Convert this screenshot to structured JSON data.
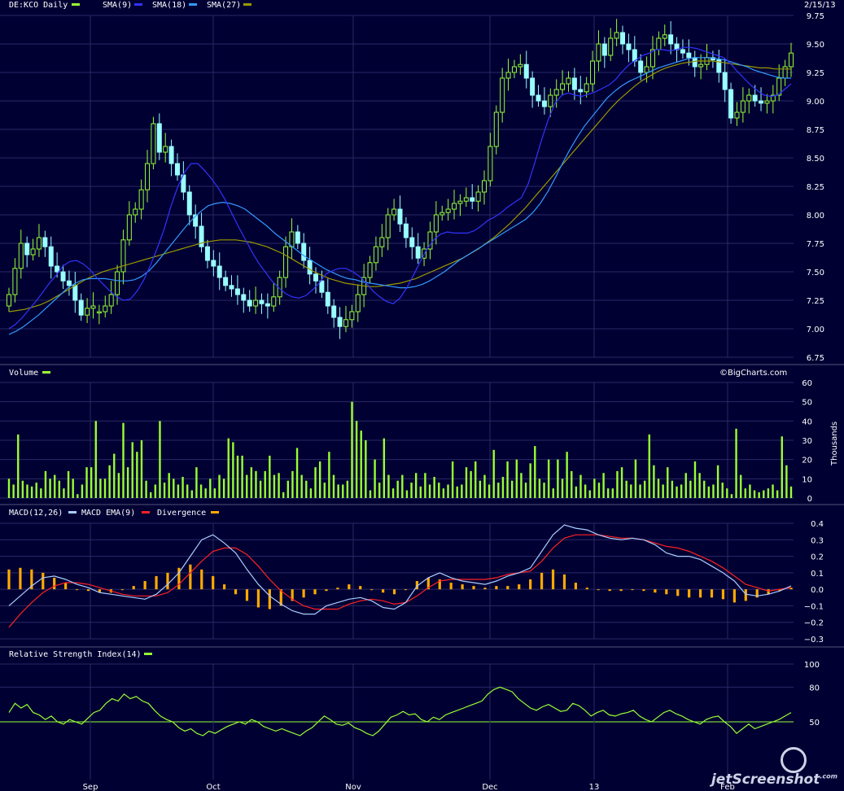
{
  "header": {
    "symbol_label": "DE:KCO Daily",
    "sma_labels": [
      "SMA(9)",
      "SMA(18)",
      "SMA(27)"
    ],
    "date": "2/15/13"
  },
  "volume_panel": {
    "label": "Volume",
    "unit": "Thousands",
    "credit": "©BigCharts.com"
  },
  "macd_panel": {
    "label1": "MACD(12,26)",
    "label2": "MACD EMA(9)",
    "label3": "Divergence"
  },
  "rsi_panel": {
    "label": "Relative Strength Index(14)"
  },
  "watermark": {
    "text": "jetScreenshot",
    "small": ".com"
  },
  "colors": {
    "background": "#000033",
    "up_candle": "#000033",
    "up_outline": "#99ff33",
    "down_candle": "#99ffff",
    "sma9": "#3333ff",
    "sma18": "#3399ff",
    "sma27": "#999900",
    "volume": "#99ff33",
    "macd": "#aaccff",
    "macd_ema": "#ff2222",
    "divergence": "#ffaa00",
    "rsi": "#99ff33"
  },
  "chart_data": [
    {
      "type": "candlestick",
      "title": "DE:KCO Daily",
      "ylim": [
        6.75,
        9.75
      ],
      "yticks": [
        "6.75",
        "7.00",
        "7.25",
        "7.50",
        "7.75",
        "8.00",
        "8.25",
        "8.50",
        "8.75",
        "9.00",
        "9.25",
        "9.50",
        "9.75"
      ],
      "x_labels": [
        "Sep",
        "Oct",
        "Nov",
        "Dec",
        "13",
        "Feb"
      ],
      "series_names": [
        "SMA(9)",
        "SMA(18)",
        "SMA(27)"
      ],
      "close": [
        7.3,
        7.53,
        7.75,
        7.65,
        7.7,
        7.8,
        7.72,
        7.55,
        7.5,
        7.42,
        7.38,
        7.25,
        7.12,
        7.18,
        7.2,
        7.15,
        7.2,
        7.3,
        7.5,
        7.78,
        8.0,
        8.05,
        8.22,
        8.45,
        8.8,
        8.55,
        8.6,
        8.45,
        8.35,
        8.2,
        8.0,
        7.9,
        7.72,
        7.6,
        7.55,
        7.45,
        7.38,
        7.35,
        7.3,
        7.25,
        7.2,
        7.25,
        7.22,
        7.2,
        7.28,
        7.45,
        7.72,
        7.85,
        7.75,
        7.6,
        7.48,
        7.42,
        7.32,
        7.2,
        7.1,
        7.02,
        7.08,
        7.15,
        7.3,
        7.45,
        7.58,
        7.72,
        7.8,
        8.0,
        8.05,
        7.92,
        7.8,
        7.72,
        7.62,
        7.7,
        7.85,
        8.0,
        8.02,
        8.05,
        8.1,
        8.12,
        8.15,
        8.12,
        8.2,
        8.3,
        8.6,
        8.9,
        9.2,
        9.25,
        9.3,
        9.32,
        9.2,
        9.05,
        9.0,
        8.95,
        9.05,
        9.1,
        9.15,
        9.2,
        9.1,
        9.08,
        9.15,
        9.35,
        9.5,
        9.4,
        9.55,
        9.6,
        9.5,
        9.45,
        9.35,
        9.25,
        9.3,
        9.45,
        9.55,
        9.58,
        9.5,
        9.45,
        9.42,
        9.38,
        9.3,
        9.32,
        9.38,
        9.36,
        9.25,
        9.1,
        8.85,
        8.9,
        9.0,
        9.05,
        9.0,
        8.98,
        9.0,
        9.05,
        9.2,
        9.3,
        9.42
      ],
      "open": [
        7.2,
        7.3,
        7.53,
        7.75,
        7.65,
        7.7,
        7.8,
        7.72,
        7.55,
        7.5,
        7.42,
        7.38,
        7.25,
        7.12,
        7.18,
        7.15,
        7.15,
        7.2,
        7.3,
        7.5,
        7.78,
        8.0,
        8.05,
        8.22,
        8.45,
        8.8,
        8.55,
        8.6,
        8.45,
        8.35,
        8.2,
        8.0,
        7.9,
        7.72,
        7.6,
        7.55,
        7.45,
        7.38,
        7.35,
        7.3,
        7.25,
        7.2,
        7.25,
        7.22,
        7.2,
        7.28,
        7.45,
        7.72,
        7.85,
        7.75,
        7.6,
        7.48,
        7.42,
        7.32,
        7.2,
        7.1,
        7.02,
        7.08,
        7.15,
        7.3,
        7.45,
        7.58,
        7.72,
        7.8,
        8.0,
        8.05,
        7.92,
        7.8,
        7.72,
        7.62,
        7.7,
        7.85,
        8.0,
        8.02,
        8.05,
        8.1,
        8.12,
        8.15,
        8.12,
        8.2,
        8.3,
        8.6,
        8.9,
        9.2,
        9.25,
        9.3,
        9.32,
        9.2,
        9.05,
        9.0,
        8.95,
        9.05,
        9.1,
        9.15,
        9.2,
        9.1,
        9.08,
        9.15,
        9.35,
        9.5,
        9.4,
        9.55,
        9.6,
        9.5,
        9.45,
        9.35,
        9.25,
        9.3,
        9.45,
        9.55,
        9.58,
        9.5,
        9.45,
        9.42,
        9.38,
        9.3,
        9.32,
        9.38,
        9.36,
        9.25,
        9.1,
        8.85,
        8.9,
        9.0,
        9.05,
        9.0,
        8.98,
        9.0,
        9.05,
        9.2,
        9.3
      ],
      "sma9": [
        7.0,
        7.04,
        7.1,
        7.17,
        7.24,
        7.32,
        7.4,
        7.47,
        7.55,
        7.59,
        7.6,
        7.57,
        7.52,
        7.45,
        7.39,
        7.33,
        7.28,
        7.25,
        7.26,
        7.33,
        7.43,
        7.56,
        7.71,
        7.87,
        8.07,
        8.24,
        8.37,
        8.45,
        8.45,
        8.39,
        8.32,
        8.24,
        8.14,
        8.02,
        7.9,
        7.79,
        7.68,
        7.58,
        7.5,
        7.42,
        7.36,
        7.31,
        7.28,
        7.27,
        7.29,
        7.34,
        7.4,
        7.48,
        7.51,
        7.53,
        7.53,
        7.5,
        7.46,
        7.4,
        7.33,
        7.28,
        7.24,
        7.22,
        7.27,
        7.36,
        7.47,
        7.59,
        7.7,
        7.78,
        7.83,
        7.85,
        7.84,
        7.84,
        7.84,
        7.86,
        7.9,
        7.95,
        7.98,
        8.02,
        8.07,
        8.11,
        8.15,
        8.27,
        8.46,
        8.66,
        8.84,
        8.98,
        9.05,
        9.07,
        9.05,
        9.04,
        9.06,
        9.08,
        9.11,
        9.14,
        9.19,
        9.26,
        9.32,
        9.36,
        9.4,
        9.42,
        9.45,
        9.45,
        9.44,
        9.45,
        9.47,
        9.47,
        9.46,
        9.44,
        9.42,
        9.4,
        9.38,
        9.33,
        9.26,
        9.2,
        9.14,
        9.09,
        9.05,
        9.04,
        9.05,
        9.1,
        9.15
      ],
      "sma18": [
        6.95,
        6.98,
        7.02,
        7.07,
        7.12,
        7.18,
        7.24,
        7.3,
        7.36,
        7.4,
        7.43,
        7.44,
        7.44,
        7.44,
        7.43,
        7.42,
        7.42,
        7.43,
        7.46,
        7.51,
        7.58,
        7.66,
        7.74,
        7.82,
        7.9,
        7.97,
        8.03,
        8.08,
        8.1,
        8.11,
        8.1,
        8.08,
        8.05,
        8.0,
        7.95,
        7.9,
        7.84,
        7.79,
        7.74,
        7.69,
        7.64,
        7.6,
        7.56,
        7.52,
        7.49,
        7.46,
        7.44,
        7.43,
        7.41,
        7.4,
        7.39,
        7.38,
        7.37,
        7.36,
        7.36,
        7.37,
        7.39,
        7.42,
        7.46,
        7.5,
        7.55,
        7.6,
        7.64,
        7.68,
        7.72,
        7.76,
        7.8,
        7.84,
        7.88,
        7.92,
        7.96,
        8.02,
        8.1,
        8.2,
        8.32,
        8.45,
        8.57,
        8.68,
        8.78,
        8.86,
        8.94,
        9.02,
        9.08,
        9.13,
        9.17,
        9.2,
        9.23,
        9.26,
        9.29,
        9.31,
        9.33,
        9.35,
        9.37,
        9.38,
        9.38,
        9.38,
        9.37,
        9.36,
        9.34,
        9.32,
        9.3,
        9.27,
        9.25,
        9.23,
        9.21,
        9.2,
        9.2
      ],
      "sma27": [
        7.15,
        7.16,
        7.17,
        7.19,
        7.21,
        7.24,
        7.28,
        7.32,
        7.36,
        7.4,
        7.44,
        7.47,
        7.5,
        7.52,
        7.54,
        7.56,
        7.58,
        7.6,
        7.62,
        7.64,
        7.66,
        7.68,
        7.7,
        7.72,
        7.74,
        7.76,
        7.77,
        7.78,
        7.78,
        7.78,
        7.77,
        7.76,
        7.74,
        7.72,
        7.69,
        7.66,
        7.62,
        7.58,
        7.54,
        7.5,
        7.47,
        7.44,
        7.42,
        7.4,
        7.39,
        7.38,
        7.37,
        7.37,
        7.38,
        7.39,
        7.4,
        7.42,
        7.44,
        7.47,
        7.5,
        7.53,
        7.56,
        7.59,
        7.62,
        7.66,
        7.7,
        7.75,
        7.8,
        7.86,
        7.92,
        7.99,
        8.06,
        8.14,
        8.22,
        8.3,
        8.38,
        8.46,
        8.54,
        8.62,
        8.7,
        8.78,
        8.86,
        8.94,
        9.01,
        9.07,
        9.13,
        9.18,
        9.22,
        9.26,
        9.29,
        9.31,
        9.33,
        9.34,
        9.35,
        9.35,
        9.35,
        9.34,
        9.33,
        9.32,
        9.31,
        9.3,
        9.29,
        9.29,
        9.28,
        9.28,
        9.28
      ]
    },
    {
      "type": "bar",
      "title": "Volume",
      "ylabel": "Thousands",
      "ylim": [
        0,
        60
      ],
      "yticks": [
        "0",
        "10",
        "20",
        "30",
        "40",
        "50",
        "60"
      ],
      "values": [
        10,
        7,
        33,
        9,
        7,
        6,
        8,
        5,
        14,
        10,
        12,
        9,
        5,
        14,
        10,
        2,
        7,
        16,
        16,
        40,
        10,
        10,
        17,
        23,
        13,
        39,
        16,
        29,
        24,
        30,
        9,
        3,
        7,
        40,
        8,
        13,
        10,
        7,
        11,
        7,
        4,
        16,
        7,
        5,
        10,
        5,
        12,
        10,
        31,
        29,
        22,
        22,
        12,
        16,
        14,
        9,
        14,
        22,
        12,
        13,
        3,
        9,
        14,
        26,
        12,
        9,
        5,
        16,
        19,
        8,
        24,
        12,
        7,
        7,
        9,
        50,
        40,
        35,
        30,
        4,
        20,
        8,
        31,
        12,
        5,
        9,
        12,
        4,
        8,
        13,
        6,
        13,
        7,
        11,
        8,
        5,
        7,
        19,
        6,
        7,
        16,
        14,
        19,
        9,
        12,
        7,
        25,
        8,
        11,
        19,
        9,
        20,
        13,
        8,
        18,
        27,
        10,
        8,
        20,
        5,
        20,
        10,
        24,
        14,
        6,
        12,
        7,
        4,
        10,
        8,
        13,
        5,
        5,
        14,
        16,
        9,
        7,
        20,
        7,
        9,
        33,
        17,
        10,
        7,
        16,
        9,
        6,
        7,
        13,
        9,
        19,
        13,
        9,
        6,
        7,
        17,
        8,
        5,
        2,
        36,
        12,
        5,
        7,
        4,
        3,
        4,
        5,
        7,
        4,
        32,
        17,
        6
      ],
      "yticks_right": true
    },
    {
      "type": "line",
      "title": "MACD(12,26)",
      "ylim": [
        -0.3,
        0.4
      ],
      "yticks": [
        "−0.3",
        "−0.2",
        "−0.1",
        "0.0",
        "0.1",
        "0.2",
        "0.3",
        "0.4"
      ],
      "series": [
        {
          "name": "MACD(12,26)",
          "values": [
            -0.1,
            -0.04,
            0.02,
            0.07,
            0.08,
            0.06,
            0.03,
            0.01,
            -0.02,
            -0.03,
            -0.04,
            -0.05,
            -0.06,
            -0.03,
            0.03,
            0.1,
            0.2,
            0.3,
            0.33,
            0.28,
            0.22,
            0.12,
            0.03,
            -0.04,
            -0.09,
            -0.13,
            -0.15,
            -0.15,
            -0.1,
            -0.08,
            -0.06,
            -0.05,
            -0.07,
            -0.11,
            -0.12,
            -0.08,
            0.02,
            0.07,
            0.1,
            0.07,
            0.05,
            0.04,
            0.03,
            0.05,
            0.08,
            0.1,
            0.13,
            0.23,
            0.33,
            0.39,
            0.37,
            0.36,
            0.33,
            0.31,
            0.3,
            0.31,
            0.3,
            0.27,
            0.22,
            0.2,
            0.2,
            0.18,
            0.14,
            0.1,
            0.05,
            -0.03,
            -0.04,
            -0.03,
            -0.01,
            0.02
          ]
        },
        {
          "name": "MACD EMA(9)",
          "values": [
            -0.23,
            -0.15,
            -0.08,
            -0.02,
            0.02,
            0.04,
            0.04,
            0.03,
            0.01,
            -0.01,
            -0.03,
            -0.04,
            -0.04,
            -0.04,
            -0.02,
            0.03,
            0.1,
            0.17,
            0.23,
            0.25,
            0.25,
            0.21,
            0.14,
            0.06,
            -0.01,
            -0.06,
            -0.1,
            -0.12,
            -0.12,
            -0.12,
            -0.09,
            -0.07,
            -0.06,
            -0.07,
            -0.09,
            -0.08,
            -0.04,
            0.01,
            0.05,
            0.06,
            0.06,
            0.06,
            0.06,
            0.07,
            0.09,
            0.1,
            0.11,
            0.17,
            0.25,
            0.31,
            0.33,
            0.33,
            0.33,
            0.32,
            0.31,
            0.31,
            0.3,
            0.28,
            0.26,
            0.25,
            0.23,
            0.2,
            0.17,
            0.13,
            0.08,
            0.03,
            0.01,
            -0.01,
            0.0,
            0.01
          ]
        },
        {
          "name": "Divergence",
          "values": [
            0.12,
            0.13,
            0.12,
            0.1,
            0.07,
            0.04,
            0.0,
            -0.01,
            -0.02,
            -0.02,
            0.0,
            0.02,
            0.05,
            0.08,
            0.1,
            0.13,
            0.15,
            0.12,
            0.08,
            0.03,
            -0.03,
            -0.07,
            -0.11,
            -0.12,
            -0.1,
            -0.07,
            -0.05,
            -0.03,
            -0.01,
            0.01,
            0.03,
            0.02,
            0.0,
            -0.02,
            -0.03,
            0.0,
            0.05,
            0.07,
            0.06,
            0.04,
            0.03,
            0.02,
            0.01,
            0.02,
            0.02,
            0.03,
            0.06,
            0.1,
            0.12,
            0.09,
            0.04,
            0.01,
            0.0,
            -0.01,
            -0.01,
            0.0,
            -0.01,
            -0.02,
            -0.03,
            -0.04,
            -0.05,
            -0.05,
            -0.05,
            -0.06,
            -0.08,
            -0.07,
            -0.05,
            -0.03,
            -0.01,
            0.01
          ]
        }
      ]
    },
    {
      "type": "line",
      "title": "Relative Strength Index(14)",
      "ylim": [
        0,
        100
      ],
      "yticks": [
        "50",
        "80",
        "100"
      ],
      "series": [
        {
          "name": "Relative Strength Index(14)",
          "values": [
            58,
            66,
            62,
            65,
            58,
            56,
            52,
            55,
            50,
            48,
            52,
            50,
            48,
            53,
            58,
            60,
            66,
            70,
            68,
            74,
            70,
            72,
            68,
            66,
            60,
            55,
            52,
            50,
            45,
            42,
            44,
            40,
            38,
            42,
            40,
            43,
            46,
            48,
            50,
            48,
            52,
            50,
            46,
            44,
            42,
            44,
            42,
            40,
            38,
            42,
            45,
            50,
            55,
            52,
            48,
            47,
            49,
            45,
            43,
            40,
            38,
            42,
            48,
            54,
            56,
            59,
            56,
            57,
            52,
            50,
            54,
            52,
            56,
            58,
            60,
            62,
            64,
            66,
            68,
            74,
            78,
            80,
            78,
            76,
            70,
            66,
            62,
            60,
            63,
            65,
            62,
            59,
            60,
            66,
            64,
            60,
            55,
            58,
            60,
            56,
            55,
            57,
            58,
            60,
            55,
            52,
            50,
            54,
            58,
            60,
            57,
            55,
            52,
            50,
            48,
            52,
            54,
            55,
            50,
            46,
            40,
            44,
            48,
            44,
            46,
            48,
            50,
            52,
            55,
            58
          ]
        }
      ]
    }
  ]
}
